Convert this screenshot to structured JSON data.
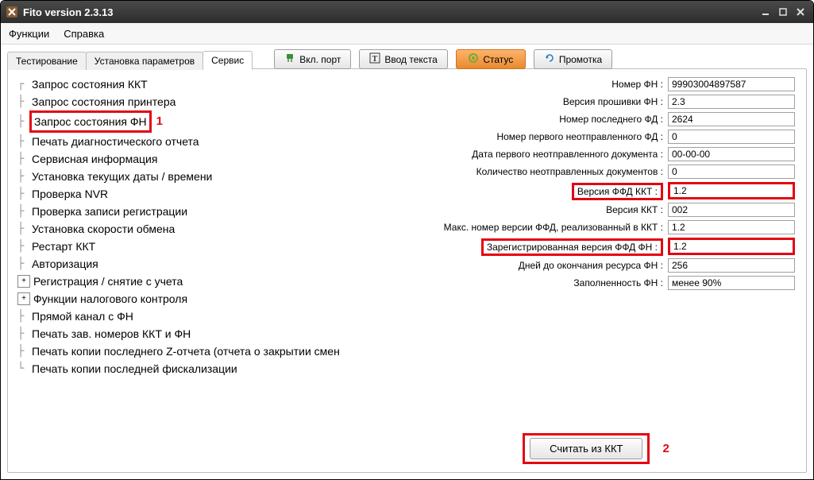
{
  "window": {
    "title": "Fito version 2.3.13"
  },
  "menu": {
    "functions": "Функции",
    "help": "Справка"
  },
  "tabs": {
    "testing": "Тестирование",
    "params": "Установка параметров",
    "service": "Сервис"
  },
  "toolbar": {
    "port": "Вкл. порт",
    "text": "Ввод текста",
    "status": "Статус",
    "rewind": "Промотка"
  },
  "tree": [
    "Запрос состояния ККТ",
    "Запрос состояния принтера",
    "Запрос состояния ФН",
    "Печать диагностического отчета",
    "Сервисная информация",
    "Установка текущих даты / времени",
    "Проверка NVR",
    "Проверка записи регистрации",
    "Установка скорости обмена",
    "Рестарт ККТ",
    "Авторизация",
    "Регистрация / снятие с учета",
    "Функции налогового контроля",
    "Прямой канал с ФН",
    "Печать зав. номеров ККТ и ФН",
    "Печать копии последнего Z-отчета (отчета о закрытии смен",
    "Печать копии последней фискализации"
  ],
  "marker1": "1",
  "marker2": "2",
  "form": {
    "rows": [
      {
        "label": "Номер ФН :",
        "value": "99903004897587"
      },
      {
        "label": "Версия прошивки ФН :",
        "value": "2.3"
      },
      {
        "label": "Номер последнего ФД :",
        "value": "2624"
      },
      {
        "label": "Номер первого неотправленного ФД :",
        "value": "0"
      },
      {
        "label": "Дата первого неотправленного документа :",
        "value": "00-00-00"
      },
      {
        "label": "Количество неотправленных документов :",
        "value": "0"
      },
      {
        "label": "Версия ФФД ККТ :",
        "value": "1.2",
        "hi": true
      },
      {
        "label": "Версия ККТ :",
        "value": "002"
      },
      {
        "label": "Макс. номер версии ФФД, реализованный в ККТ :",
        "value": "1.2"
      },
      {
        "label": "Зарегистрированная версия ФФД ФН :",
        "value": "1.2",
        "hi": true
      },
      {
        "label": "Дней до окончания ресурса ФН :",
        "value": "256"
      },
      {
        "label": "Заполненность ФН :",
        "value": "менее 90%"
      }
    ]
  },
  "readBtn": "Считать из ККТ"
}
